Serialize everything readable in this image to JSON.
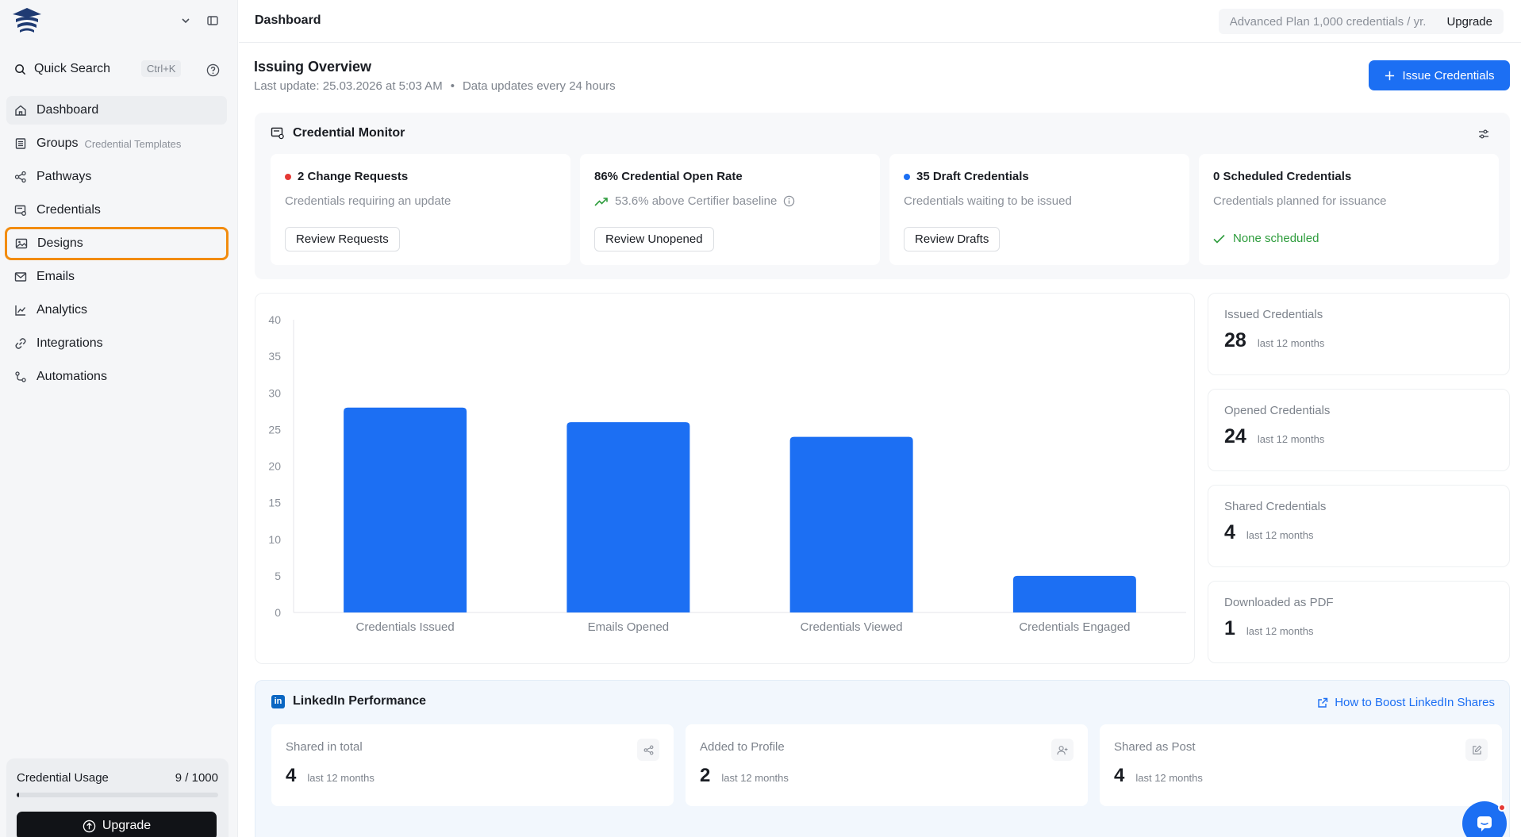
{
  "sidebar": {
    "search_label": "Quick Search",
    "search_shortcut": "Ctrl+K",
    "nav": [
      {
        "label": "Dashboard",
        "sub": ""
      },
      {
        "label": "Groups",
        "sub": "Credential Templates"
      },
      {
        "label": "Pathways",
        "sub": ""
      },
      {
        "label": "Credentials",
        "sub": ""
      },
      {
        "label": "Designs",
        "sub": ""
      },
      {
        "label": "Emails",
        "sub": ""
      },
      {
        "label": "Analytics",
        "sub": ""
      },
      {
        "label": "Integrations",
        "sub": ""
      },
      {
        "label": "Automations",
        "sub": ""
      }
    ],
    "usage": {
      "label": "Credential Usage",
      "count": "9 / 1000",
      "fraction": 0.009
    },
    "upgrade_label": "Upgrade"
  },
  "topbar": {
    "title": "Dashboard",
    "plan_text": "Advanced Plan 1,000 credentials / yr.",
    "plan_upgrade": "Upgrade"
  },
  "overview": {
    "title": "Issuing Overview",
    "last_update": "Last update: 25.03.2026 at 5:03 AM",
    "separator": "•",
    "update_note": "Data updates every 24 hours",
    "issue_button": "Issue Credentials"
  },
  "monitor": {
    "title": "Credential Monitor",
    "cards": [
      {
        "title": "2 Change Requests",
        "sub": "Credentials requiring an update",
        "button": "Review Requests"
      },
      {
        "title": "86% Credential Open Rate",
        "sub": "53.6% above Certifier baseline",
        "button": "Review Unopened"
      },
      {
        "title": "35 Draft Credentials",
        "sub": "Credentials waiting to be issued",
        "button": "Review Drafts"
      },
      {
        "title": "0 Scheduled Credentials",
        "sub": "Credentials planned for issuance",
        "status": "None scheduled"
      }
    ]
  },
  "chart_data": {
    "type": "bar",
    "categories": [
      "Credentials Issued",
      "Emails Opened",
      "Credentials Viewed",
      "Credentials Engaged"
    ],
    "values": [
      28,
      26,
      24,
      5
    ],
    "ylim": [
      0,
      40
    ],
    "yticks": [
      0,
      5,
      10,
      15,
      20,
      25,
      30,
      35,
      40
    ],
    "bar_color": "#1c6ff3",
    "grid": false
  },
  "stats": [
    {
      "label": "Issued Credentials",
      "value": "28",
      "period": "last 12 months"
    },
    {
      "label": "Opened Credentials",
      "value": "24",
      "period": "last 12 months"
    },
    {
      "label": "Shared Credentials",
      "value": "4",
      "period": "last 12 months"
    },
    {
      "label": "Downloaded as PDF",
      "value": "1",
      "period": "last 12 months"
    }
  ],
  "linkedin": {
    "logo_text": "in",
    "title": "LinkedIn Performance",
    "link": "How to Boost LinkedIn Shares",
    "cards": [
      {
        "label": "Shared in total",
        "value": "4",
        "period": "last 12 months",
        "icon": "share-icon"
      },
      {
        "label": "Added to Profile",
        "value": "2",
        "period": "last 12 months",
        "icon": "user-plus-icon"
      },
      {
        "label": "Shared as Post",
        "value": "4",
        "period": "last 12 months",
        "icon": "edit-icon"
      }
    ]
  },
  "colors": {
    "accent": "#1c6ff3",
    "highlight": "#f28c0f",
    "alert": "#e53935",
    "success": "#2d9c3c"
  }
}
